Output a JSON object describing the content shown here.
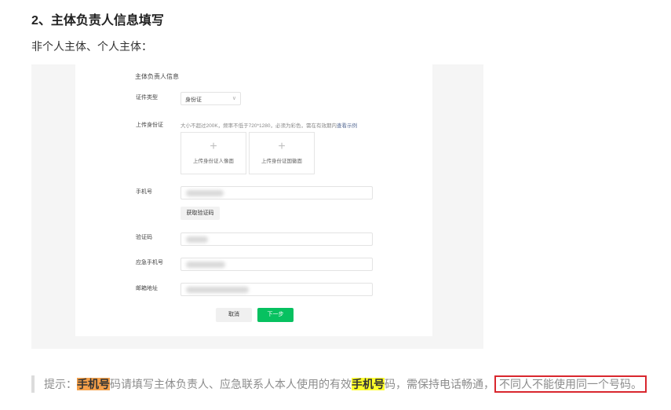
{
  "heading": "2、主体负责人信息填写",
  "subtitle": "非个人主体、个人主体：",
  "form": {
    "section_title": "主体负责人信息",
    "id_type_label": "证件类型",
    "id_type_value": "身份证",
    "upload_label": "上传身份证",
    "upload_hint": "大小不超过200K，频率不低于720*1280，必须为彩色，需在有效期内",
    "upload_hint_link": "查看示例",
    "upload_front": "上传身份证人像面",
    "upload_back": "上传身份证国徽面",
    "phone_label": "手机号",
    "get_code_button": "获取验证码",
    "code_label": "验证码",
    "emergency_phone_label": "应急手机号",
    "email_label": "邮箱地址",
    "cancel_button": "取消",
    "next_button": "下一步"
  },
  "tip": {
    "prefix": "提示：",
    "hl1": "手机号",
    "mid": "码请填写主体负责人、应急联系人本人使用的有效",
    "hl2": "手机号",
    "suffix": "码，需保持电话畅通，",
    "boxed": "不同人不能使用同一个号码。"
  },
  "colors": {
    "primary_button": "#07c160",
    "highlight_orange": "#f5a04a",
    "highlight_yellow": "#ffff2b",
    "annotation_box": "#d9272e"
  }
}
